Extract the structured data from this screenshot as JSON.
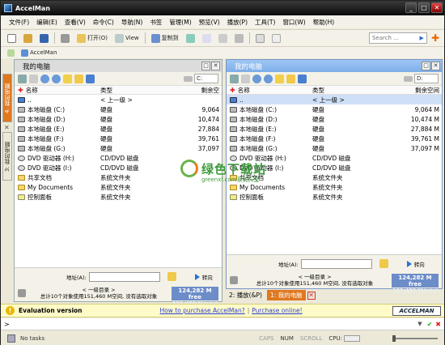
{
  "window": {
    "title": "AccelMan",
    "btn_min": "_",
    "btn_max": "□",
    "btn_close": "✕"
  },
  "menu": [
    "文件(F)",
    "编辑(E)",
    "查看(V)",
    "命令(C)",
    "导航(N)",
    "书签",
    "管理(M)",
    "预览(V)",
    "播放(P)",
    "工具(T)",
    "窗口(W)",
    "帮助(H)"
  ],
  "toolbar": {
    "open": "打开(O)",
    "view": "View",
    "copy_to": "复制到",
    "search_placeholder": "Search ..."
  },
  "favorites": {
    "item": "AccelMan"
  },
  "side_tabs": [
    "4: 我的电脑",
    "3: 我的电脑"
  ],
  "columns": {
    "name": "名称",
    "type": "类型",
    "free": "剩余空"
  },
  "columns_right": {
    "name": "名称",
    "type": "类型",
    "free": "剩余空间"
  },
  "left_panel": {
    "title": "我的电脑",
    "drive": "C:",
    "rows": [
      {
        "name": "..",
        "type": "< 上一级 >",
        "free": "",
        "icon": "up"
      },
      {
        "name": "本地磁盘 (C:)",
        "type": "硬盘",
        "free": "9,064",
        "icon": "hdd"
      },
      {
        "name": "本地磁盘 (D:)",
        "type": "硬盘",
        "free": "10,474",
        "icon": "hdd"
      },
      {
        "name": "本地磁盘 (E:)",
        "type": "硬盘",
        "free": "27,884",
        "icon": "hdd"
      },
      {
        "name": "本地磁盘 (F:)",
        "type": "硬盘",
        "free": "39,761",
        "icon": "hdd"
      },
      {
        "name": "本地磁盘 (G:)",
        "type": "硬盘",
        "free": "37,097",
        "icon": "hdd"
      },
      {
        "name": "DVD 驱动器 (H:)",
        "type": "CD/DVD 磁盘",
        "free": "",
        "icon": "dvd"
      },
      {
        "name": "DVD 驱动器 (I:)",
        "type": "CD/DVD 磁盘",
        "free": "",
        "icon": "dvd"
      },
      {
        "name": "共享文档",
        "type": "系统文件夹",
        "free": "",
        "icon": "folder"
      },
      {
        "name": "My Documents",
        "type": "系统文件夹",
        "free": "",
        "icon": "folder"
      },
      {
        "name": "控制面板",
        "type": "系统文件夹",
        "free": "",
        "icon": "ctrl"
      }
    ],
    "addr_label": "地址(A):",
    "go_label": "转向",
    "info_line1": "< 一级目录 >",
    "info_line2": "总计10个对象使用151,460 M空间, 没有选取对象",
    "free_main": "124,282 M free",
    "free_sub": "151,460 M total"
  },
  "right_panel": {
    "title": "我的电脑",
    "drive": "D:",
    "rows": [
      {
        "name": "..",
        "type": "< 上一级 >",
        "free": "",
        "icon": "up"
      },
      {
        "name": "本地磁盘 (C:)",
        "type": "硬盘",
        "free": "9,064 M",
        "icon": "hdd"
      },
      {
        "name": "本地磁盘 (D:)",
        "type": "硬盘",
        "free": "10,474 M",
        "icon": "hdd"
      },
      {
        "name": "本地磁盘 (E:)",
        "type": "硬盘",
        "free": "27,884 M",
        "icon": "hdd"
      },
      {
        "name": "本地磁盘 (F:)",
        "type": "硬盘",
        "free": "39,761 M",
        "icon": "hdd"
      },
      {
        "name": "本地磁盘 (G:)",
        "type": "硬盘",
        "free": "37,097 M",
        "icon": "hdd"
      },
      {
        "name": "DVD 驱动器 (H:)",
        "type": "CD/DVD 磁盘",
        "free": "",
        "icon": "dvd"
      },
      {
        "name": "DVD 驱动器 (I:)",
        "type": "CD/DVD 磁盘",
        "free": "",
        "icon": "dvd"
      },
      {
        "name": "共享文档",
        "type": "系统文件夹",
        "free": "",
        "icon": "folder"
      },
      {
        "name": "My Documents",
        "type": "系统文件夹",
        "free": "",
        "icon": "folder"
      },
      {
        "name": "控制面板",
        "type": "系统文件夹",
        "free": "",
        "icon": "ctrl"
      }
    ],
    "addr_label": "地址(A):",
    "go_label": "转向",
    "info_line1": "< 一级目录 >",
    "info_line2": "总计10个对象使用151,460 M空间, 没有选取对象",
    "free_main": "124,282 M free",
    "free_sub": "151,460 M total"
  },
  "bottom_tabs": [
    "2: 播放(&P)",
    "1: 我的电脑"
  ],
  "evaluation": {
    "label": "Evaluation version",
    "link1": "How to purchase AccelMan?",
    "link2": "Purchase online!",
    "brand": "ACCELMAN"
  },
  "cmdline": {
    "prompt": ">"
  },
  "status": {
    "tasks": "No tasks",
    "caps": "CAPS",
    "num": "NUM",
    "scroll": "SCROLL",
    "cpu": "CPU:"
  },
  "watermark": {
    "text": "绿色下载站",
    "sub": "greenxf.com系统天堂"
  }
}
